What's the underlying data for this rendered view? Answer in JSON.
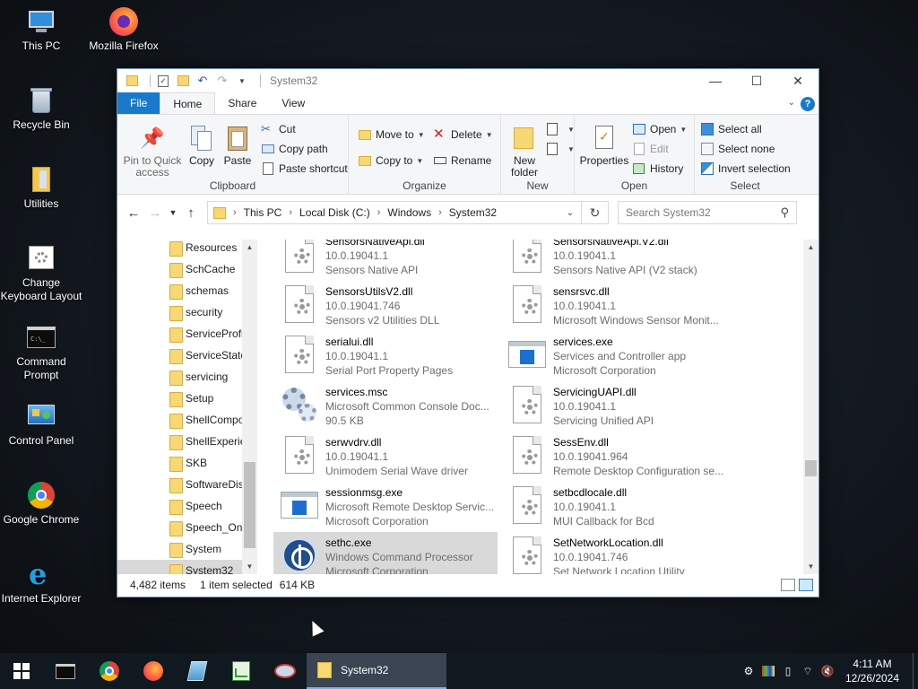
{
  "desktop": {
    "icons": [
      {
        "label": "This PC",
        "icon": "this-pc-icon"
      },
      {
        "label": "Mozilla Firefox",
        "icon": "firefox-icon"
      },
      {
        "label": "Recycle Bin",
        "icon": "recycle-bin-icon"
      },
      {
        "label": "Utilities",
        "icon": "folder-icon"
      },
      {
        "label": "Change Keyboard Layout",
        "icon": "keyboard-layout-icon"
      },
      {
        "label": "Command Prompt",
        "icon": "command-prompt-icon"
      },
      {
        "label": "Control Panel",
        "icon": "control-panel-icon"
      },
      {
        "label": "Google Chrome",
        "icon": "chrome-icon"
      },
      {
        "label": "Internet Explorer",
        "icon": "internet-explorer-icon"
      }
    ]
  },
  "window": {
    "title": "System32",
    "tabs": {
      "file": "File",
      "home": "Home",
      "share": "Share",
      "view": "View"
    },
    "help": "?"
  },
  "ribbon": {
    "clipboard": {
      "label": "Clipboard",
      "pin": "Pin to Quick access",
      "copy": "Copy",
      "paste": "Paste",
      "cut": "Cut",
      "copy_path": "Copy path",
      "paste_shortcut": "Paste shortcut"
    },
    "organize": {
      "label": "Organize",
      "move_to": "Move to",
      "copy_to": "Copy to",
      "delete": "Delete",
      "rename": "Rename"
    },
    "new": {
      "label": "New",
      "new_folder": "New folder"
    },
    "open": {
      "label": "Open",
      "properties": "Properties",
      "open": "Open",
      "edit": "Edit",
      "history": "History"
    },
    "select": {
      "label": "Select",
      "select_all": "Select all",
      "select_none": "Select none",
      "invert": "Invert selection"
    }
  },
  "address": {
    "crumbs": [
      "This PC",
      "Local Disk (C:)",
      "Windows",
      "System32"
    ],
    "search_placeholder": "Search System32"
  },
  "nav_pane": {
    "items": [
      {
        "label": "Resources"
      },
      {
        "label": "SchCache"
      },
      {
        "label": "schemas"
      },
      {
        "label": "security"
      },
      {
        "label": "ServiceProfi"
      },
      {
        "label": "ServiceState"
      },
      {
        "label": "servicing"
      },
      {
        "label": "Setup"
      },
      {
        "label": "ShellCompo"
      },
      {
        "label": "ShellExperie"
      },
      {
        "label": "SKB"
      },
      {
        "label": "SoftwareDis"
      },
      {
        "label": "Speech"
      },
      {
        "label": "Speech_One"
      },
      {
        "label": "System"
      },
      {
        "label": "System32"
      }
    ]
  },
  "files": [
    {
      "name": "SensorsNativeApi.dll",
      "line2": "10.0.19041.1",
      "line3": "Sensors Native API",
      "icon": "dll"
    },
    {
      "name": "SensorsNativeApi.V2.dll",
      "line2": "10.0.19041.1",
      "line3": "Sensors Native API (V2 stack)",
      "icon": "dll"
    },
    {
      "name": "SensorsUtilsV2.dll",
      "line2": "10.0.19041.746",
      "line3": "Sensors v2 Utilities DLL",
      "icon": "dll"
    },
    {
      "name": "sensrsvc.dll",
      "line2": "10.0.19041.1",
      "line3": "Microsoft Windows Sensor Monit...",
      "icon": "dll"
    },
    {
      "name": "serialui.dll",
      "line2": "10.0.19041.1",
      "line3": "Serial Port Property Pages",
      "icon": "dll"
    },
    {
      "name": "services.exe",
      "line2": "Services and Controller app",
      "line3": "Microsoft Corporation",
      "icon": "exe"
    },
    {
      "name": "services.msc",
      "line2": "Microsoft Common Console Doc...",
      "line3": "90.5 KB",
      "icon": "msc"
    },
    {
      "name": "ServicingUAPI.dll",
      "line2": "10.0.19041.1",
      "line3": "Servicing Unified API",
      "icon": "dll"
    },
    {
      "name": "serwvdrv.dll",
      "line2": "10.0.19041.1",
      "line3": "Unimodem Serial Wave driver",
      "icon": "dll"
    },
    {
      "name": "SessEnv.dll",
      "line2": "10.0.19041.964",
      "line3": "Remote Desktop Configuration se...",
      "icon": "dll"
    },
    {
      "name": "sessionmsg.exe",
      "line2": "Microsoft Remote Desktop Servic...",
      "line3": "Microsoft Corporation",
      "icon": "exe"
    },
    {
      "name": "setbcdlocale.dll",
      "line2": "10.0.19041.1",
      "line3": "MUI Callback for Bcd",
      "icon": "dll"
    },
    {
      "name": "sethc.exe",
      "line2": "Windows Command Processor",
      "line3": "Microsoft Corporation",
      "icon": "sethc"
    },
    {
      "name": "SetNetworkLocation.dll",
      "line2": "10.0.19041.746",
      "line3": "Set Network Location Utility",
      "icon": "dll"
    }
  ],
  "status": {
    "items": "4,482 items",
    "selected": "1 item selected",
    "size": "614 KB"
  },
  "taskbar": {
    "open_window": "System32",
    "time": "4:11 AM",
    "date": "12/26/2024"
  }
}
